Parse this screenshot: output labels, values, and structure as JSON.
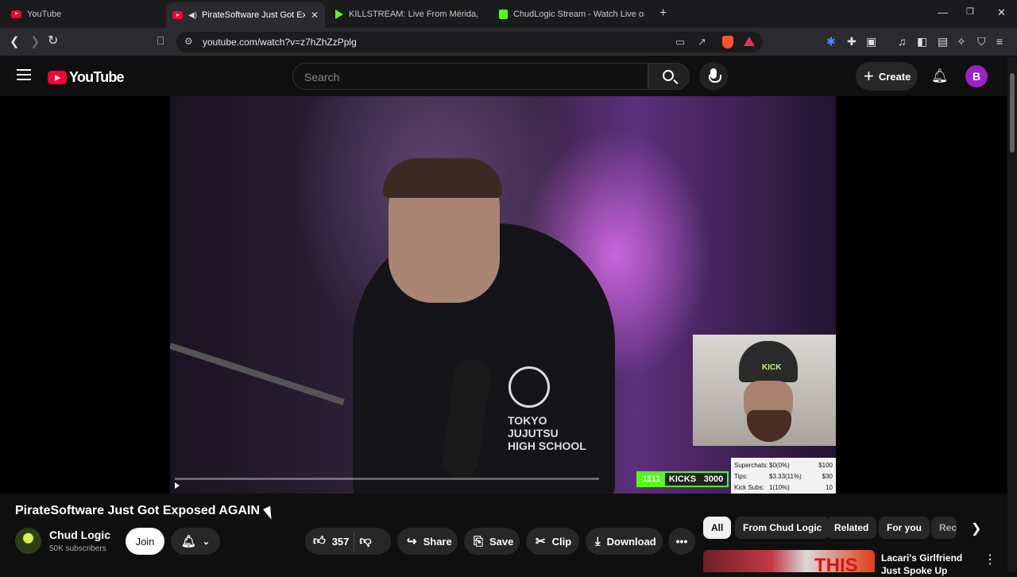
{
  "browser": {
    "tabs": [
      {
        "title": "YouTube",
        "favicon": "youtube-icon"
      },
      {
        "title": "PirateSoftware Just Got Expos",
        "favicon": "youtube-icon",
        "active": true
      },
      {
        "title": "KILLSTREAM: Live From Mérida, Mex",
        "favicon": "play-icon"
      },
      {
        "title": "ChudLogic Stream - Watch Live on Ki",
        "favicon": "kick-icon"
      }
    ],
    "new_tab_label": "+",
    "url": "youtube.com/watch?v=z7hZhZzPplg"
  },
  "youtube": {
    "logo_text": "YouTube",
    "search_placeholder": "Search",
    "create_label": "Create",
    "avatar_letter": "B"
  },
  "video": {
    "cap_text": "KICK",
    "shirt_text": "TOKYO\nJUJUTSU\nHIGH SCHOOL",
    "stats": [
      {
        "label": "Superchats:",
        "value": "$0(0%)",
        "goal": "$100"
      },
      {
        "label": "Tips:",
        "value": "$3.33(11%)",
        "goal": "$30"
      },
      {
        "label": "Kick Subs:",
        "value": "1(10%)",
        "goal": "10"
      }
    ],
    "kicks": {
      "current": "1111",
      "label": "KICKS",
      "goal": "3000"
    },
    "progress_fraction": 0.0
  },
  "meta": {
    "title": "PirateSoftware Just Got Exposed AGAIN",
    "channel_name": "Chud Logic",
    "subscribers": "50K subscribers",
    "join_label": "Join",
    "likes": "357",
    "share_label": "Share",
    "save_label": "Save",
    "clip_label": "Clip",
    "download_label": "Download"
  },
  "sidebar": {
    "chips": [
      "All",
      "From Chud Logic",
      "Related",
      "For you",
      "Rec"
    ],
    "first_video_title": "Lacari's Girlfriend Just Spoke Up",
    "thumb_text": "THIS"
  },
  "colors": {
    "accent": "#ff0033",
    "kick_green": "#53fc18"
  }
}
